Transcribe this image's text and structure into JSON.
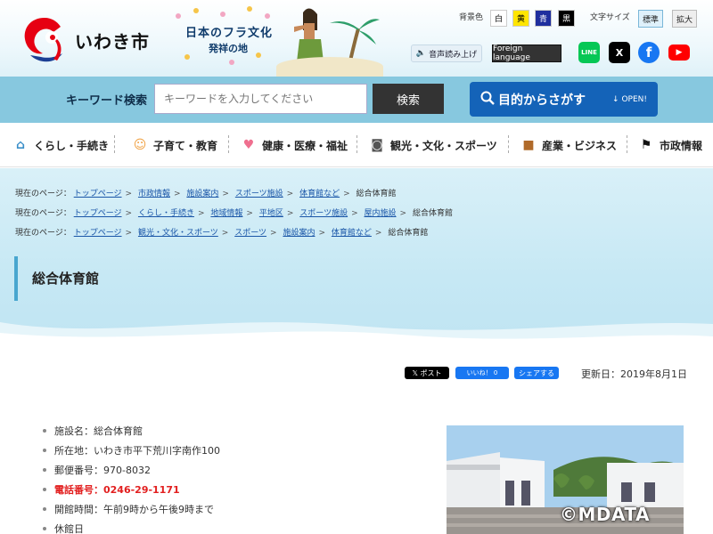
{
  "header": {
    "logo_text": "いわき市",
    "banner_line1": "日本のフラ文化",
    "banner_line2": "発祥の地",
    "bg_color_label": "背景色",
    "bg_colors": [
      {
        "label": "白",
        "bg": "#ffffff",
        "fg": "#000000"
      },
      {
        "label": "黄",
        "bg": "#ffe500",
        "fg": "#000000"
      },
      {
        "label": "青",
        "bg": "#1f2f9e",
        "fg": "#ffffff"
      },
      {
        "label": "黒",
        "bg": "#000000",
        "fg": "#ffffff"
      }
    ],
    "text_size_label": "文字サイズ",
    "size_standard": "標準",
    "size_large": "拡大",
    "speech_button": "音声読み上げ",
    "language_button": "Foreign language",
    "sns": [
      {
        "name": "line-icon",
        "label": "LINE",
        "color": "#06c755"
      },
      {
        "name": "x-icon",
        "label": "X",
        "color": "#000000"
      },
      {
        "name": "facebook-icon",
        "label": "f",
        "color": "#1877f2"
      },
      {
        "name": "youtube-icon",
        "label": "▶",
        "color": "#ff0000"
      }
    ]
  },
  "search": {
    "label": "キーワード検索",
    "placeholder": "キーワードを入力してください",
    "button": "検索",
    "purpose_button": "目的からさがす",
    "purpose_open": "OPEN!"
  },
  "nav": {
    "items": [
      {
        "label": "くらし・手続き"
      },
      {
        "label": "子育て・教育"
      },
      {
        "label": "健康・医療・福祉"
      },
      {
        "label": "観光・文化・スポーツ"
      },
      {
        "label": "産業・ビジネス"
      },
      {
        "label": "市政情報"
      }
    ]
  },
  "breadcrumbs": {
    "prefix": "現在のページ：",
    "rows": [
      [
        "トップページ",
        "市政情報",
        "施設案内",
        "スポーツ施設",
        "体育館など",
        "総合体育館"
      ],
      [
        "トップページ",
        "くらし・手続き",
        "地域情報",
        "平地区",
        "スポーツ施設",
        "屋内施設",
        "総合体育館"
      ],
      [
        "トップページ",
        "観光・文化・スポーツ",
        "スポーツ",
        "施設案内",
        "体育館など",
        "総合体育館"
      ]
    ]
  },
  "page": {
    "title": "総合体育館",
    "share_x": "ポスト",
    "share_like": "いいね！ 0",
    "share_fb": "シェアする",
    "updated": "更新日：2019年8月1日",
    "info": [
      "施設名：総合体育館",
      "所在地：いわき市平下荒川字南作100",
      "郵便番号：970-8032",
      "電話番号：0246-29-1171",
      "開館時間：午前9時から午後9時まで",
      "休館日"
    ],
    "watermark": "©MDATA"
  }
}
